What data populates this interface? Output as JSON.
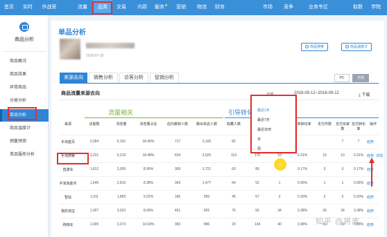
{
  "nav": [
    {
      "label": "首页"
    },
    {
      "label": "实时"
    },
    {
      "label": "作战室"
    },
    {
      "label": "流量"
    },
    {
      "label": "品类"
    },
    {
      "label": "交易"
    },
    {
      "label": "内容"
    },
    {
      "label": "服务"
    },
    {
      "label": "营销"
    },
    {
      "label": "物流"
    },
    {
      "label": "财务"
    },
    {
      "label": "市场"
    },
    {
      "label": "竞争"
    },
    {
      "label": "业务专区"
    },
    {
      "label": "取数"
    },
    {
      "label": "学院"
    }
  ],
  "sidebar": {
    "title": "商品分析",
    "items": [
      {
        "label": "商品概况"
      },
      {
        "label": "商品效果"
      },
      {
        "label": "异常商品"
      },
      {
        "label": "分类分析"
      },
      {
        "label": "单品分析"
      },
      {
        "label": "商品温度计"
      },
      {
        "label": "销量预测"
      },
      {
        "label": "单品服务分析"
      }
    ]
  },
  "main": {
    "title": "单品分析",
    "product_date": "2018-07-30",
    "btn_change": "商品搜索",
    "btn_thermo": "商品温度计",
    "tabs": [
      {
        "label": "来源去向"
      },
      {
        "label": "销售分析"
      },
      {
        "label": "访客分析"
      },
      {
        "label": "促销分析"
      }
    ],
    "seg_pc": "PC",
    "seg_wireless": "无线",
    "section_title": "商品流量来源去向",
    "period_label": "日期",
    "date_range": "2018-09-12~2018-09-12",
    "download": "下载",
    "group1": "流量相关",
    "group2": "引导转化",
    "columns": [
      "来源",
      "访客数",
      "浏览量",
      "浏览量占比",
      "店内跳转人数",
      "跳出本店人数",
      "收藏人数",
      "加购人数",
      "下单买家数",
      "下单转化率",
      "支付件数",
      "支付买家数",
      "支付转化率",
      "操作"
    ],
    "dropdown": [
      "最近1天",
      "最近7天",
      "最近30天",
      "日",
      "周"
    ],
    "dropdown_extra": [
      "日",
      "月"
    ],
    "op_trend": "趋势",
    "op_detail": "详情",
    "rows": [
      {
        "src": "手淘首页",
        "v": [
          "3,284",
          "6,191",
          "18.45%",
          "717",
          "3,165",
          "82",
          "",
          "",
          "",
          "",
          "7",
          "7",
          "0.21%"
        ],
        "detail": ""
      },
      {
        "src": "手淘搜索",
        "v": [
          "3,231",
          "6,210",
          "18.48%",
          "624",
          "3,025",
          "119",
          "170",
          "10",
          "0.31%",
          "10",
          "10",
          "0.31%",
          ""
        ],
        "detail": "详情"
      },
      {
        "src": "直通车",
        "v": [
          "1,812",
          "3,005",
          "8.95%",
          "369",
          "1,721",
          "60",
          "85",
          "3",
          "0.17%",
          "3",
          "3",
          "0.17%",
          ""
        ],
        "detail": ""
      },
      {
        "src": "手淘淘金币",
        "v": [
          "1,545",
          "2,815",
          "8.38%",
          "369",
          "1,477",
          "64",
          "52",
          "1",
          "0.06%",
          "1",
          "1",
          "0.06%",
          ""
        ],
        "detail": ""
      },
      {
        "src": "智钻",
        "v": [
          "1,011",
          "1,855",
          "5.52%",
          "186",
          "955",
          "45",
          "57",
          "3",
          "0.30%",
          "2",
          "2",
          "0.20%",
          ""
        ],
        "detail": ""
      },
      {
        "src": "我的淘宝",
        "v": [
          "1,007",
          "3,022",
          "8.99%",
          "461",
          "826",
          "76",
          "56",
          "34",
          "3.38%",
          "39",
          "34",
          "3.38%",
          ""
        ],
        "detail": ""
      },
      {
        "src": "购物车",
        "v": [
          "1,005",
          "3,373",
          "10.04%",
          "383",
          "896",
          "20",
          "134",
          "40",
          "3.98%",
          "39",
          "39",
          "3.88%",
          ""
        ],
        "detail": ""
      }
    ]
  },
  "watermark": "知乎 @将库",
  "colors": {
    "nav_bg": "#3a8fd9",
    "accent": "#2f86d6",
    "highlight": "#e52d2d",
    "green": "#7ab33a"
  }
}
